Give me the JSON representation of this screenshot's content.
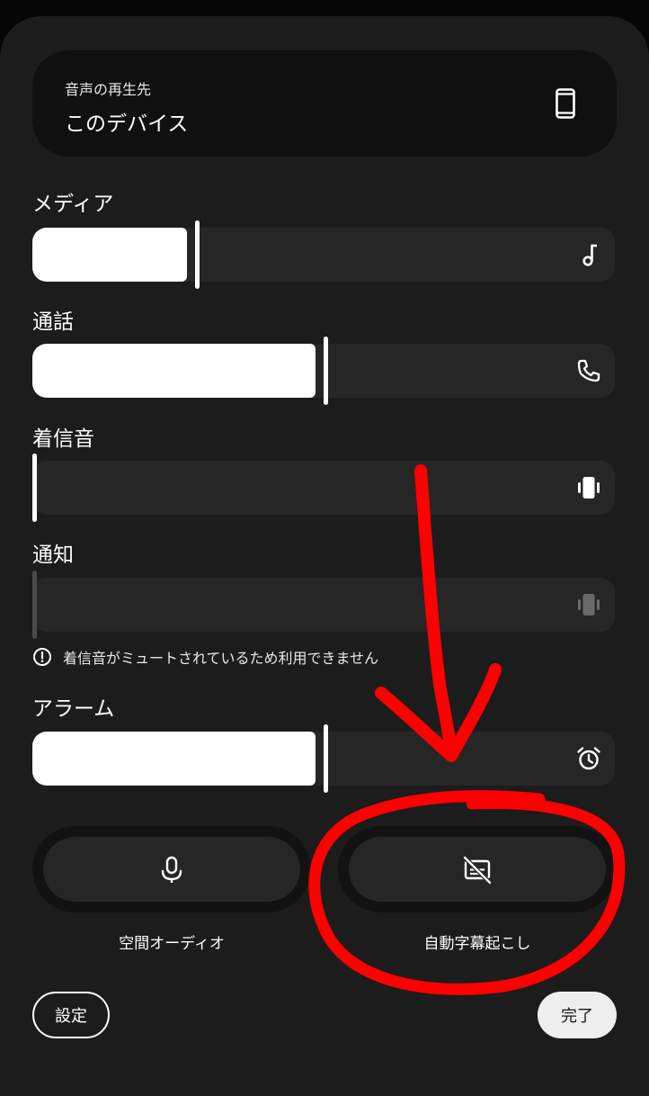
{
  "output": {
    "label": "音声の再生先",
    "value": "このデバイス",
    "icon": "smartphone-icon"
  },
  "volumes": [
    {
      "label": "メディア",
      "level": 0.28,
      "icon": "music-note-icon",
      "enabled": true
    },
    {
      "label": "通話",
      "level": 0.5,
      "icon": "phone-icon",
      "enabled": true
    },
    {
      "label": "着信音",
      "level": 0.0,
      "icon": "vibrate-icon",
      "enabled": true
    },
    {
      "label": "通知",
      "level": 0.0,
      "icon": "vibrate-icon",
      "enabled": false
    },
    {
      "label": "アラーム",
      "level": 0.5,
      "icon": "alarm-icon",
      "enabled": true
    }
  ],
  "mute_note": "着信音がミュートされているため利用できません",
  "toggles": [
    {
      "label": "空間オーディオ",
      "icon": "spatial-audio-icon"
    },
    {
      "label": "自動字幕起こし",
      "icon": "captions-off-icon"
    }
  ],
  "buttons": {
    "settings": "設定",
    "done": "完了"
  },
  "colors": {
    "panel": "#1c1c1c",
    "track": "#262626",
    "fill": "#ffffff",
    "annotation": "#ff0000"
  }
}
